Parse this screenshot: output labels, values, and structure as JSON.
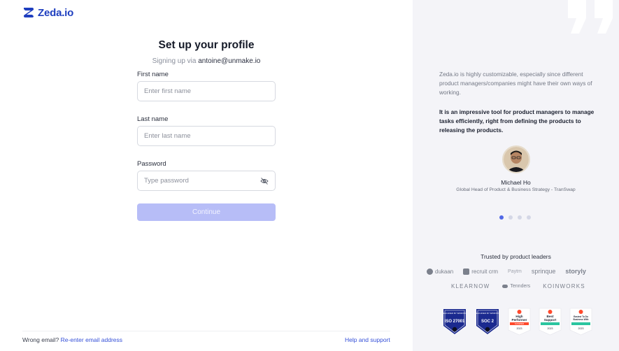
{
  "brand": {
    "name": "Zeda.io",
    "accent": "#1f3fbf"
  },
  "form": {
    "title": "Set up your profile",
    "subtitle_prefix": "Signing up via ",
    "email": "antoine@unmake.io",
    "first_name_label": "First name",
    "first_name_placeholder": "Enter first name",
    "first_name_value": "",
    "last_name_label": "Last name",
    "last_name_placeholder": "Enter last name",
    "last_name_value": "",
    "password_label": "Password",
    "password_placeholder": "Type password",
    "password_value": "",
    "continue_label": "Continue",
    "continue_color": "#b7bdf7"
  },
  "footer": {
    "wrong_email_text": "Wrong email? ",
    "reenter_link": "Re-enter email address",
    "help_link": "Help and support"
  },
  "testimonial": {
    "quote": "Zeda.io is highly customizable, especially since different product managers/companies might have their own ways of working.",
    "quote_bold": "It is an impressive tool for product managers to manage tasks efficiently, right from defining the products to releasing the products.",
    "name": "Michael Ho",
    "role": "Global Head of Product & Business Strategy - TranSwap",
    "active_slide": 1,
    "total_slides": 4
  },
  "trusted": {
    "heading": "Trusted by product leaders",
    "row1": [
      "dukaan",
      "recruit crm",
      "Paytm",
      "sprinque",
      "storyly"
    ],
    "row2": [
      "KLEARNOW",
      "Tennders",
      "KOINWORKS"
    ]
  },
  "badges": {
    "shield1": {
      "top": "SECURED BY SPRINTO",
      "main": "ISO 27001"
    },
    "shield2": {
      "top": "SECURED BY SPRINTO",
      "main": "SOC 2"
    },
    "g2_1": {
      "line1": "High",
      "line2": "Performer",
      "tag": "SUMMER",
      "year": "2023"
    },
    "g2_2": {
      "line1": "Best",
      "line2": "Support",
      "year": "2023"
    },
    "g2_3": {
      "line1": "Easiest To Do",
      "line2": "Business With",
      "year": "2023"
    }
  }
}
